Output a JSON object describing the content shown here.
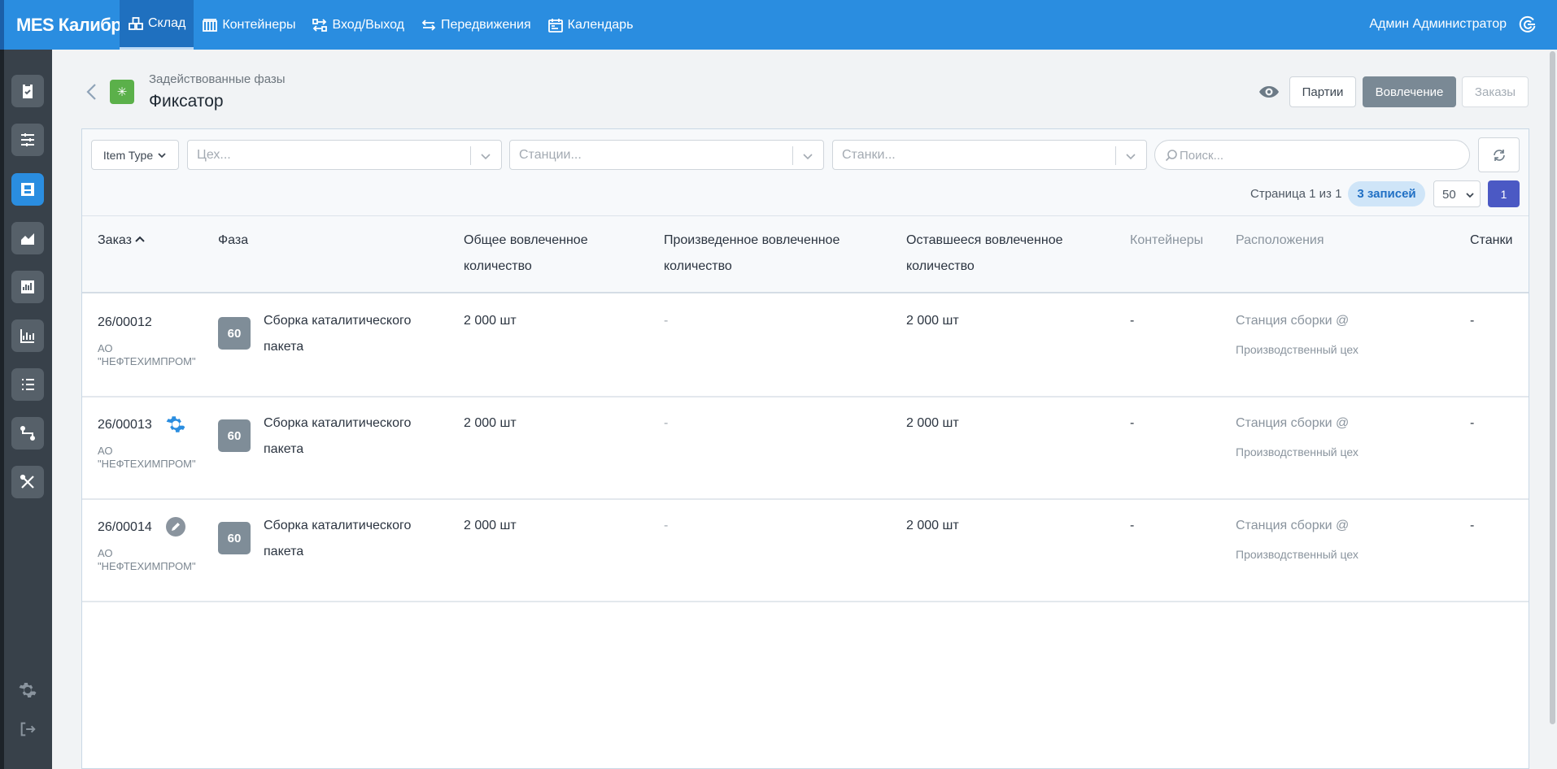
{
  "app": {
    "brand": "MES Калибр",
    "user_name": "Админ Администратор"
  },
  "nav": [
    {
      "label": "Склад",
      "icon": "warehouse-icon",
      "active": true
    },
    {
      "label": "Контейнеры",
      "icon": "containers-icon"
    },
    {
      "label": "Вход/Выход",
      "icon": "in-out-icon"
    },
    {
      "label": "Передвижения",
      "icon": "transfers-icon"
    },
    {
      "label": "Календарь",
      "icon": "calendar-icon"
    }
  ],
  "sidebar": {
    "items": [
      {
        "icon": "clipboard-check-icon"
      },
      {
        "icon": "sliders-icon"
      },
      {
        "icon": "storage-icon",
        "active": true
      },
      {
        "icon": "area-chart-icon"
      },
      {
        "icon": "bar-chart-icon"
      },
      {
        "icon": "line-chart-icon"
      },
      {
        "icon": "list-icon"
      },
      {
        "icon": "route-icon"
      },
      {
        "icon": "tools-icon"
      }
    ],
    "bottom": [
      {
        "icon": "settings-gear-icon"
      },
      {
        "icon": "logout-icon"
      }
    ]
  },
  "header": {
    "subtitle": "Задействованные фазы",
    "title": "Фиксатор",
    "buttons": {
      "parties": "Партии",
      "involvement": "Вовлечение",
      "orders": "Заказы"
    }
  },
  "filters": {
    "item_type": "Item Type",
    "workshop_placeholder": "Цех...",
    "stations_placeholder": "Станции...",
    "machines_placeholder": "Станки...",
    "search_placeholder": "Поиск..."
  },
  "pagination": {
    "page_info": "Страница 1 из 1",
    "records": "3 записей",
    "per_page": "50",
    "current_page": "1"
  },
  "table": {
    "columns": {
      "order": "Заказ",
      "phase": "Фаза",
      "total_1": "Общее вовлеченное",
      "total_2": "количество",
      "produced_1": "Произведенное вовлеченное",
      "produced_2": "количество",
      "remaining_1": "Оставшееся вовлеченное",
      "remaining_2": "количество",
      "containers": "Контейнеры",
      "locations": "Расположения",
      "machines": "Станки"
    },
    "rows": [
      {
        "order": "26/00012",
        "customer": "АО \"НЕФТЕХИМПРОМ\"",
        "phase_num": "60",
        "phase": "Сборка каталитического пакета",
        "total": "2 000 шт",
        "produced": "-",
        "remaining": "2 000 шт",
        "containers": "-",
        "location_1": "Станция сборки @",
        "location_2": "Производственный цех",
        "machines": "-",
        "icon": ""
      },
      {
        "order": "26/00013",
        "customer": "АО \"НЕФТЕХИМПРОМ\"",
        "phase_num": "60",
        "phase": "Сборка каталитического пакета",
        "total": "2 000 шт",
        "produced": "-",
        "remaining": "2 000 шт",
        "containers": "-",
        "location_1": "Станция сборки @",
        "location_2": "Производственный цех",
        "machines": "-",
        "icon": "gear-icon"
      },
      {
        "order": "26/00014",
        "customer": "АО \"НЕФТЕХИМПРОМ\"",
        "phase_num": "60",
        "phase": "Сборка каталитического пакета",
        "total": "2 000 шт",
        "produced": "-",
        "remaining": "2 000 шт",
        "containers": "-",
        "location_1": "Станция сборки @",
        "location_2": "Производственный цех",
        "machines": "-",
        "icon": "pencil-icon"
      }
    ]
  },
  "colors": {
    "topbar": "#2a8de0",
    "sidebar": "#38414a",
    "accent_button": "#4b59c4",
    "involvement_button": "#7a8995",
    "phase_badge": "#7f8d98"
  }
}
